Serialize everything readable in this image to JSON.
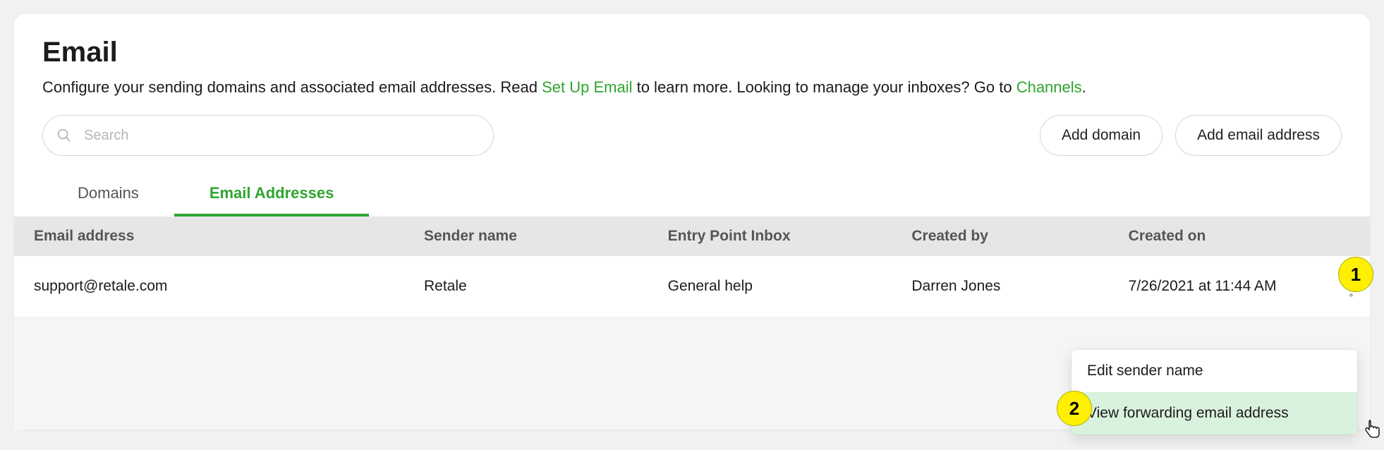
{
  "page": {
    "title": "Email",
    "subtitle_parts": {
      "pre": "Configure your sending domains and associated email addresses. Read ",
      "link1": "Set Up Email",
      "mid": " to learn more. Looking to manage your inboxes? Go to ",
      "link2": "Channels",
      "post": "."
    }
  },
  "search": {
    "placeholder": "Search"
  },
  "buttons": {
    "add_domain": "Add domain",
    "add_email": "Add email address"
  },
  "tabs": {
    "domains": "Domains",
    "email_addresses": "Email Addresses"
  },
  "table": {
    "headers": {
      "email": "Email address",
      "sender": "Sender name",
      "entry": "Entry Point Inbox",
      "created_by": "Created by",
      "created_on": "Created on"
    },
    "rows": [
      {
        "email": "support@retale.com",
        "sender": "Retale",
        "entry": "General help",
        "created_by": "Darren Jones",
        "created_on": "7/26/2021 at 11:44 AM"
      }
    ]
  },
  "dropdown": {
    "edit_sender": "Edit sender name",
    "view_forwarding": "View forwarding email address"
  },
  "annotations": {
    "one": "1",
    "two": "2"
  }
}
